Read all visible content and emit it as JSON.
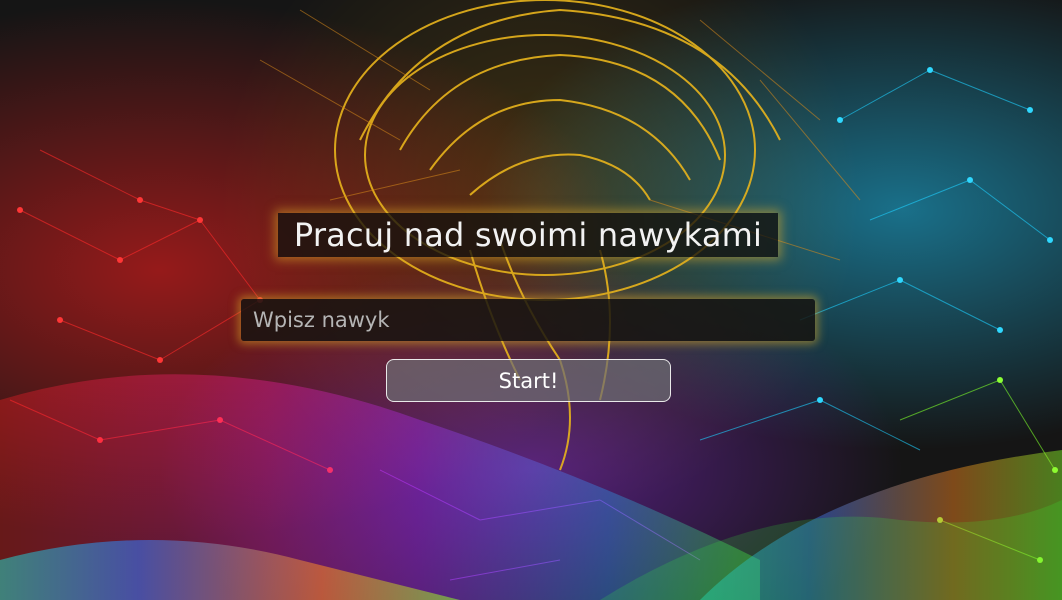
{
  "page": {
    "title": "Pracuj nad swoimi nawykami"
  },
  "form": {
    "habit_placeholder": "Wpisz nawyk",
    "habit_value": "",
    "start_label": "Start!"
  },
  "background": {
    "image": "brain-network-illustration",
    "colors": {
      "base": "#151515",
      "brain": "#e8b41c",
      "left_network": "#ff2a2a",
      "right_network": "#2ad4ff",
      "far_right_network": "#7dff2a",
      "center_network": "#c23cff"
    }
  },
  "theme": {
    "glow": "#d9a628",
    "button_border": "#e9e9e9"
  }
}
